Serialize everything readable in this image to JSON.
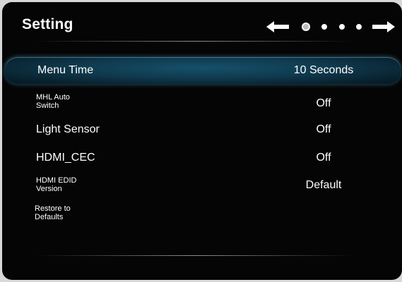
{
  "header": {
    "title": "Setting"
  },
  "pager": {
    "pages": 4,
    "current_page": 1,
    "left_arrow_icon": "left-arrow-icon",
    "right_arrow_icon": "right-arrow-icon"
  },
  "items": [
    {
      "label": "Menu Time",
      "value": "10 Seconds",
      "selected": true
    },
    {
      "label": "MHL Auto Switch",
      "value": "Off"
    },
    {
      "label": "Light Sensor",
      "value": "Off"
    },
    {
      "label": "HDMI_CEC",
      "value": "Off"
    },
    {
      "label": "HDMI EDID Version",
      "value": "Default"
    },
    {
      "label": "Restore to Defaults",
      "value": ""
    }
  ],
  "colors": {
    "background": "#050505",
    "text": "#ffffff",
    "highlight": "#0f3a4e"
  }
}
